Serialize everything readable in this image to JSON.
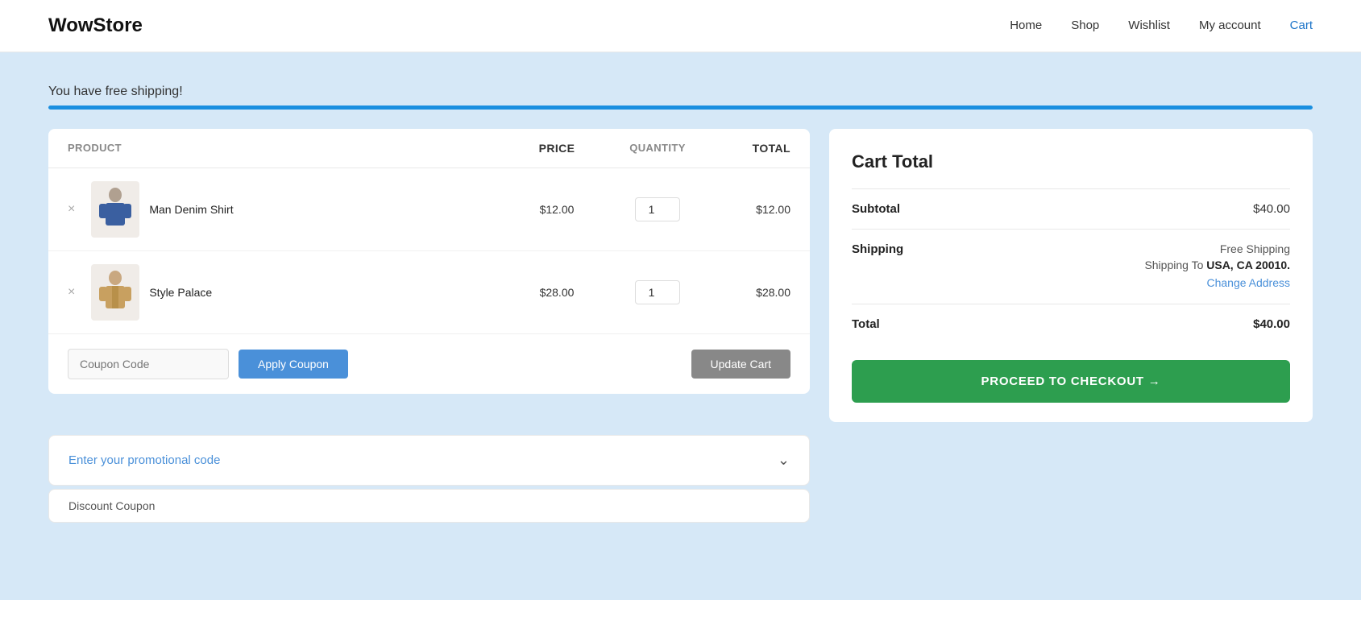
{
  "header": {
    "logo": "WowStore",
    "nav": [
      {
        "label": "Home",
        "href": "#",
        "active": false
      },
      {
        "label": "Shop",
        "href": "#",
        "active": false
      },
      {
        "label": "Wishlist",
        "href": "#",
        "active": false
      },
      {
        "label": "My account",
        "href": "#",
        "active": false
      },
      {
        "label": "Cart",
        "href": "#",
        "active": true
      }
    ]
  },
  "shipping_banner": {
    "text": "You have free shipping!",
    "progress": 100
  },
  "cart": {
    "table": {
      "columns": [
        "Product",
        "Price",
        "Quantity",
        "Total"
      ],
      "rows": [
        {
          "name": "Man Denim Shirt",
          "price": "$12.00",
          "quantity": 1,
          "total": "$12.00"
        },
        {
          "name": "Style Palace",
          "price": "$28.00",
          "quantity": 1,
          "total": "$28.00"
        }
      ]
    },
    "coupon_placeholder": "Coupon Code",
    "apply_coupon_label": "Apply Coupon",
    "update_cart_label": "Update Cart"
  },
  "promo": {
    "label_prefix": "Enter your ",
    "label_highlight": "promotional code",
    "discount_label": "Discount Coupon"
  },
  "cart_total": {
    "title": "Cart Total",
    "subtotal_label": "Subtotal",
    "subtotal_value": "$40.00",
    "shipping_label": "Shipping",
    "shipping_type": "Free Shipping",
    "shipping_to_text": "Shipping To",
    "shipping_location": "USA, CA 20010.",
    "change_address_label": "Change Address",
    "total_label": "Total",
    "total_value": "$40.00",
    "checkout_label": "PROCEED TO CHECKOUT →"
  }
}
